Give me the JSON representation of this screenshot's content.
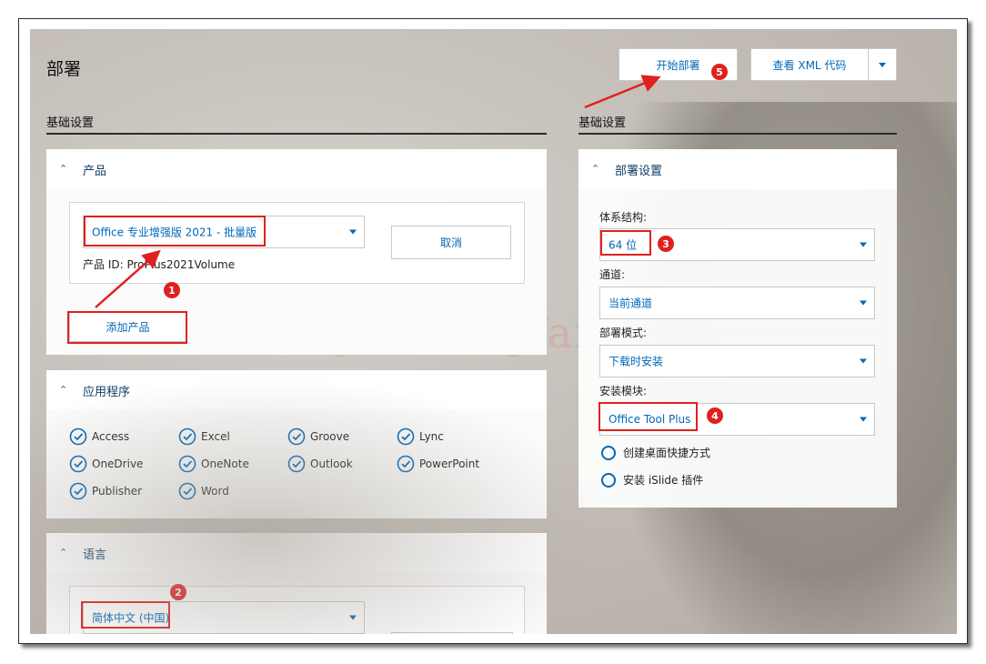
{
  "page": {
    "title": "部署"
  },
  "toolbar": {
    "deploy_label": "开始部署",
    "view_xml_label": "查看 XML 代码"
  },
  "left": {
    "section_heading": "基础设置",
    "product_panel": {
      "title": "产品",
      "product_select_value": "Office 专业增强版 2021 - 批量版",
      "product_id_text": "产品 ID: ProPlus2021Volume",
      "cancel_label": "取消",
      "add_product_label": "添加产品"
    },
    "apps_panel": {
      "title": "应用程序",
      "apps": [
        "Access",
        "Excel",
        "Groove",
        "Lync",
        "OneDrive",
        "OneNote",
        "Outlook",
        "PowerPoint",
        "Publisher",
        "Word"
      ]
    },
    "language_panel": {
      "title": "语言",
      "language_select_value": "简体中文 (中国)"
    }
  },
  "right": {
    "section_heading": "基础设置",
    "deploy_settings": {
      "title": "部署设置",
      "arch_label": "体系结构:",
      "arch_value": "64 位",
      "channel_label": "通道:",
      "channel_value": "当前通道",
      "mode_label": "部署模式:",
      "mode_value": "下载时安装",
      "module_label": "安装模块:",
      "module_value": "Office Tool Plus",
      "option_shortcut": "创建桌面快捷方式",
      "option_islide": "安装 iSlide 插件"
    }
  },
  "annotations": {
    "markers": [
      "1",
      "2",
      "3",
      "4",
      "5"
    ],
    "watermark": "云东方yundongfang"
  },
  "colors": {
    "accent": "#0067b8",
    "annotation_red": "#e02020"
  }
}
